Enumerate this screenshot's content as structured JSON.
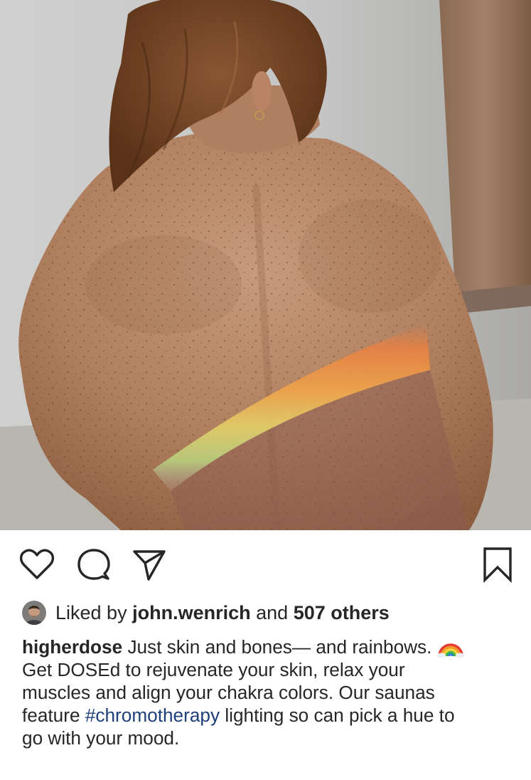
{
  "post": {
    "photo": {
      "icon": "rainbow-on-back-photo",
      "colors": {
        "wall": "#c9c6c0",
        "skin": "#b7866a",
        "hair": "#7a4a2a"
      }
    },
    "actions": {
      "like_icon": "heart-outline-icon",
      "comment_icon": "speech-bubble-icon",
      "share_icon": "paper-plane-icon",
      "save_icon": "bookmark-icon"
    },
    "likes": {
      "prefix": "Liked by",
      "user": "john.wenrich",
      "conjunction": "and",
      "others": "507 others"
    },
    "caption": {
      "username": "higherdose",
      "line1_text": "Just skin and bones— and rainbows.",
      "emoji": "rainbow-emoji",
      "line2": "Get DOSEd to rejuvenate your skin, relax your",
      "line3": "muscles and align your chakra colors. Our saunas",
      "line4_before": "feature",
      "hashtag": "#chromotherapy",
      "line4_after": "lighting so can pick a hue to",
      "line5": "go with your mood."
    },
    "colors": {
      "text": "#262626",
      "hashtag": "#1e3f7a"
    }
  }
}
